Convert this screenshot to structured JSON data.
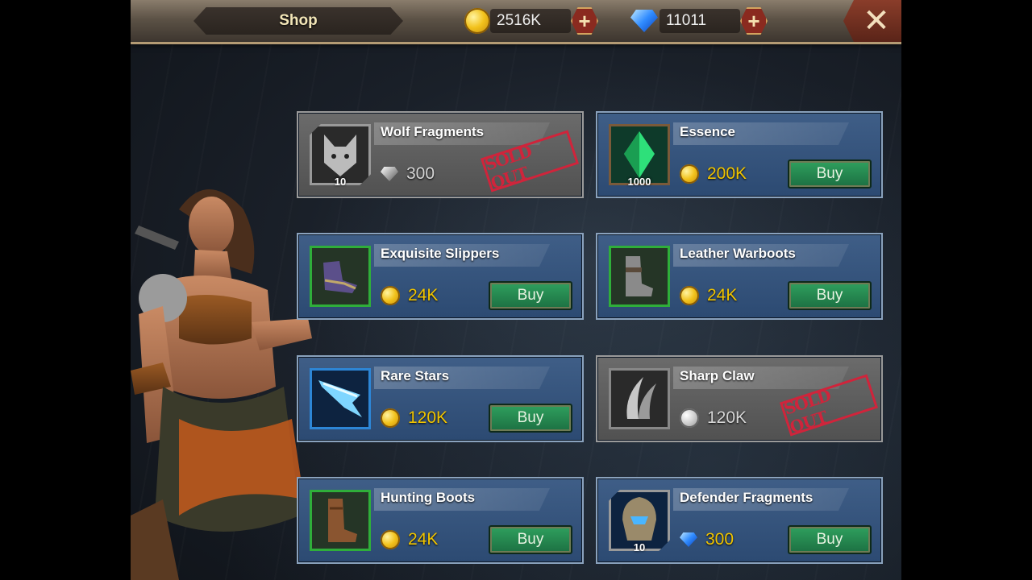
{
  "header": {
    "title": "Shop",
    "gold": "2516K",
    "gems": "11011",
    "plus_label": "+",
    "close_label": "✕"
  },
  "sold_out_label": "SOLD OUT",
  "buy_label": "Buy",
  "items": [
    {
      "name": "Wolf Fragments",
      "price": "300",
      "currency": "gem",
      "qty": "10",
      "sold_out": true,
      "icon": "wolf-fragment-icon"
    },
    {
      "name": "Essence",
      "price": "200K",
      "currency": "gold",
      "qty": "1000",
      "sold_out": false,
      "icon": "essence-crystal-icon"
    },
    {
      "name": "Exquisite Slippers",
      "price": "24K",
      "currency": "gold",
      "qty": "",
      "sold_out": false,
      "icon": "slippers-icon"
    },
    {
      "name": "Leather Warboots",
      "price": "24K",
      "currency": "gold",
      "qty": "",
      "sold_out": false,
      "icon": "warboots-icon"
    },
    {
      "name": "Rare Stars",
      "price": "120K",
      "currency": "gold",
      "qty": "",
      "sold_out": false,
      "icon": "rare-stars-blade-icon"
    },
    {
      "name": "Sharp Claw",
      "price": "120K",
      "currency": "gold",
      "qty": "",
      "sold_out": true,
      "icon": "sharp-claw-icon"
    },
    {
      "name": "Hunting Boots",
      "price": "24K",
      "currency": "gold",
      "qty": "",
      "sold_out": false,
      "icon": "hunting-boots-icon"
    },
    {
      "name": "Defender Fragments",
      "price": "300",
      "currency": "gem",
      "qty": "10",
      "sold_out": false,
      "icon": "defender-fragment-icon"
    }
  ]
}
